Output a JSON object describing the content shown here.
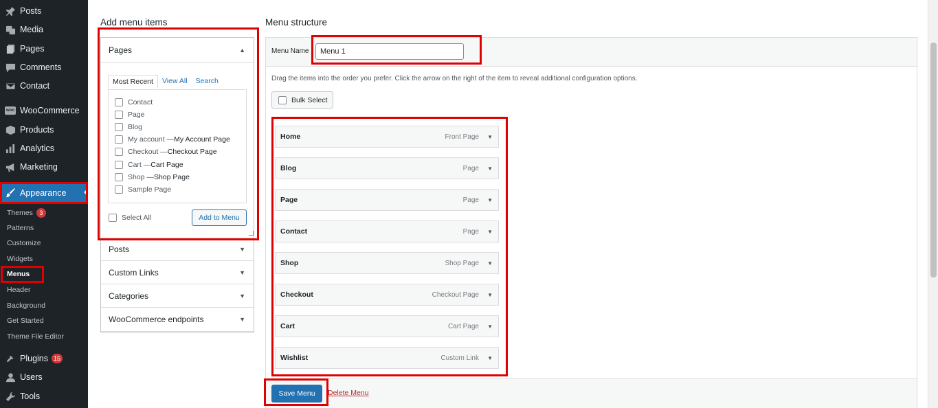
{
  "sidebar": {
    "top_items": [
      {
        "label": "Posts",
        "icon": "pin-icon"
      },
      {
        "label": "Media",
        "icon": "media-icon"
      },
      {
        "label": "Pages",
        "icon": "pages-icon"
      },
      {
        "label": "Comments",
        "icon": "comment-icon"
      },
      {
        "label": "Contact",
        "icon": "mail-icon"
      },
      {
        "label": "WooCommerce",
        "icon": "woo-icon"
      },
      {
        "label": "Products",
        "icon": "box-icon"
      },
      {
        "label": "Analytics",
        "icon": "bar-chart-icon"
      },
      {
        "label": "Marketing",
        "icon": "megaphone-icon"
      },
      {
        "label": "Appearance",
        "icon": "brush-icon"
      }
    ],
    "sub_items": [
      {
        "label": "Themes",
        "badge": "3"
      },
      {
        "label": "Patterns"
      },
      {
        "label": "Customize"
      },
      {
        "label": "Widgets"
      },
      {
        "label": "Menus"
      },
      {
        "label": "Header"
      },
      {
        "label": "Background"
      },
      {
        "label": "Get Started"
      },
      {
        "label": "Theme File Editor"
      }
    ],
    "bottom_items": [
      {
        "label": "Plugins",
        "icon": "plug-icon",
        "badge": "15"
      },
      {
        "label": "Users",
        "icon": "user-icon"
      },
      {
        "label": "Tools",
        "icon": "wrench-icon"
      }
    ]
  },
  "add_items": {
    "title": "Add menu items",
    "pages_label": "Pages",
    "tabs": [
      "Most Recent",
      "View All",
      "Search"
    ],
    "pages": [
      {
        "name": "Contact",
        "suffix": ""
      },
      {
        "name": "Page",
        "suffix": ""
      },
      {
        "name": "Blog",
        "suffix": ""
      },
      {
        "name": "My account — ",
        "suffix": "My Account Page"
      },
      {
        "name": "Checkout — ",
        "suffix": "Checkout Page"
      },
      {
        "name": "Cart — ",
        "suffix": "Cart Page"
      },
      {
        "name": "Shop — ",
        "suffix": "Shop Page"
      },
      {
        "name": "Sample Page",
        "suffix": ""
      }
    ],
    "select_all": "Select All",
    "add_button": "Add to Menu",
    "sections": [
      "Posts",
      "Custom Links",
      "Categories",
      "WooCommerce endpoints"
    ]
  },
  "structure": {
    "title": "Menu structure",
    "menu_name_label": "Menu Name",
    "menu_name_value": "Menu 1",
    "instructions": "Drag the items into the order you prefer. Click the arrow on the right of the item to reveal additional configuration options.",
    "bulk_select": "Bulk Select",
    "items": [
      {
        "title": "Home",
        "type": "Front Page"
      },
      {
        "title": "Blog",
        "type": "Page"
      },
      {
        "title": "Page",
        "type": "Page"
      },
      {
        "title": "Contact",
        "type": "Page"
      },
      {
        "title": "Shop",
        "type": "Shop Page"
      },
      {
        "title": "Checkout",
        "type": "Checkout Page"
      },
      {
        "title": "Cart",
        "type": "Cart Page"
      },
      {
        "title": "Wishlist",
        "type": "Custom Link"
      }
    ],
    "save_button": "Save Menu",
    "delete_link": "Delete Menu"
  },
  "colors": {
    "highlight": "#e00000",
    "accent": "#2271b1",
    "sidebar_bg": "#1d2327"
  }
}
